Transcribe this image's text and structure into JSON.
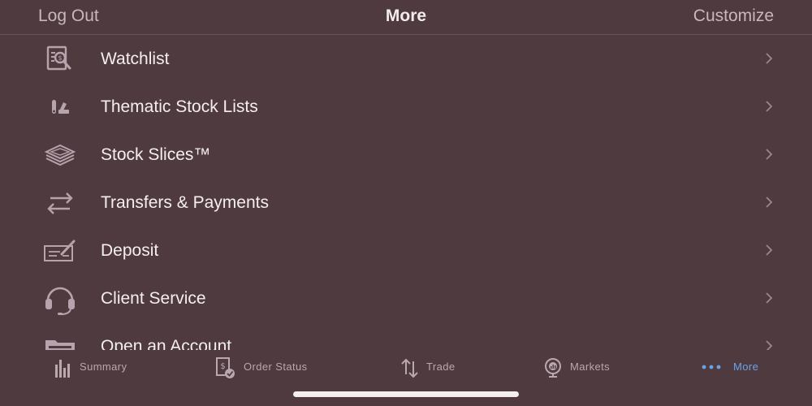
{
  "header": {
    "left_label": "Log Out",
    "title": "More",
    "right_label": "Customize"
  },
  "menu": {
    "items": [
      {
        "label": "Watchlist",
        "icon": "watchlist-search-icon"
      },
      {
        "label": "Thematic Stock Lists",
        "icon": "thematic-lists-icon"
      },
      {
        "label": "Stock Slices™",
        "icon": "stacked-layers-icon"
      },
      {
        "label": "Transfers & Payments",
        "icon": "transfer-arrows-icon"
      },
      {
        "label": "Deposit",
        "icon": "check-pen-icon"
      },
      {
        "label": "Client Service",
        "icon": "headset-icon"
      },
      {
        "label": "Open an Account",
        "icon": "folder-icon"
      }
    ]
  },
  "tabs": {
    "items": [
      {
        "label": "Summary",
        "icon": "bar-chart-icon"
      },
      {
        "label": "Order Status",
        "icon": "order-status-icon"
      },
      {
        "label": "Trade",
        "icon": "up-down-arrows-icon"
      },
      {
        "label": "Markets",
        "icon": "globe-chart-icon"
      },
      {
        "label": "More",
        "icon": "more-dots-icon",
        "active": true
      }
    ]
  },
  "colors": {
    "background": "#4f3a40",
    "icon": "#b7a3ac",
    "text": "#f4eef0",
    "muted_text": "#c8b7bd",
    "active_tab": "#6aa2e8"
  }
}
